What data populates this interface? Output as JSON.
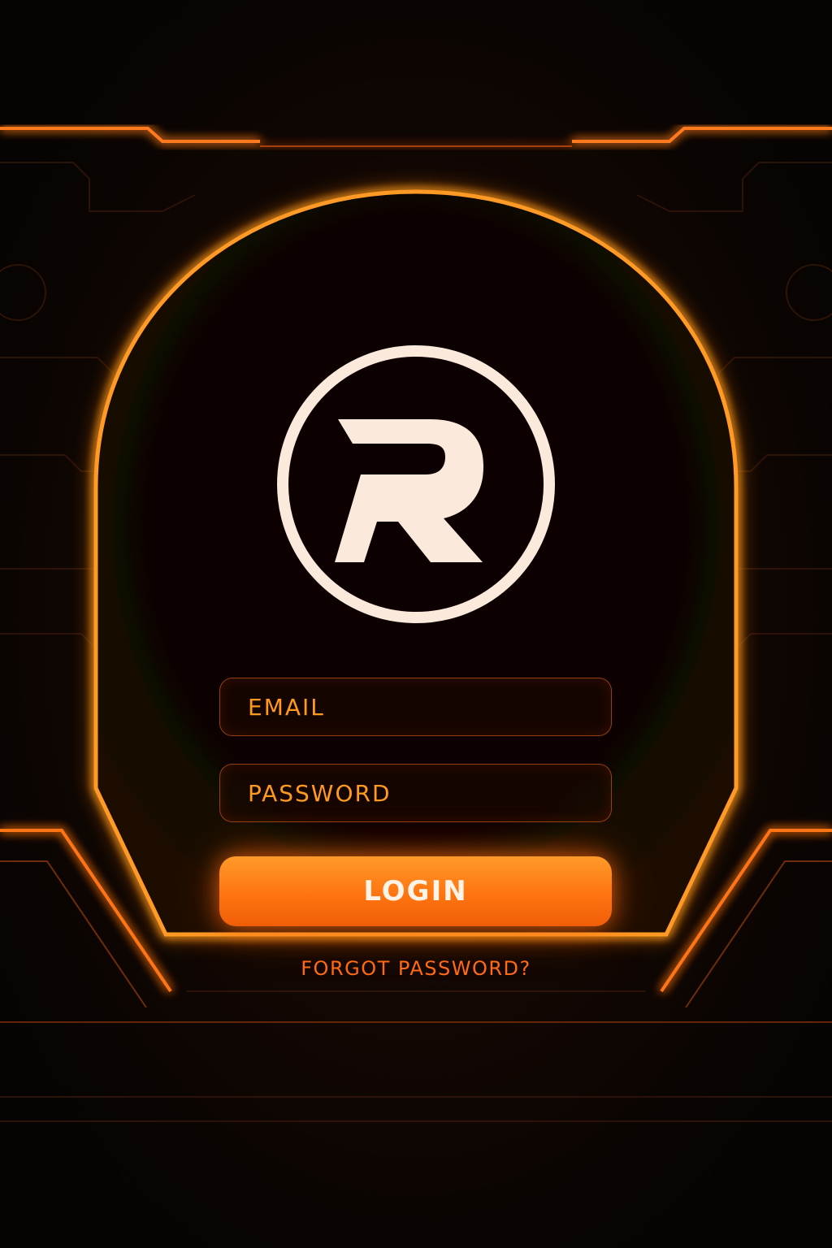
{
  "login_form": {
    "email_placeholder": "EMAIL",
    "password_placeholder": "PASSWORD",
    "login_label": "LOGIN",
    "forgot_password_label": "FORGOT PASSWORD?"
  },
  "logo": {
    "letter": "R"
  },
  "colors": {
    "accent": "#ff7a1a",
    "accent_glow": "#ffb040",
    "logo_color": "#fbe9dc",
    "background": "#050302"
  }
}
